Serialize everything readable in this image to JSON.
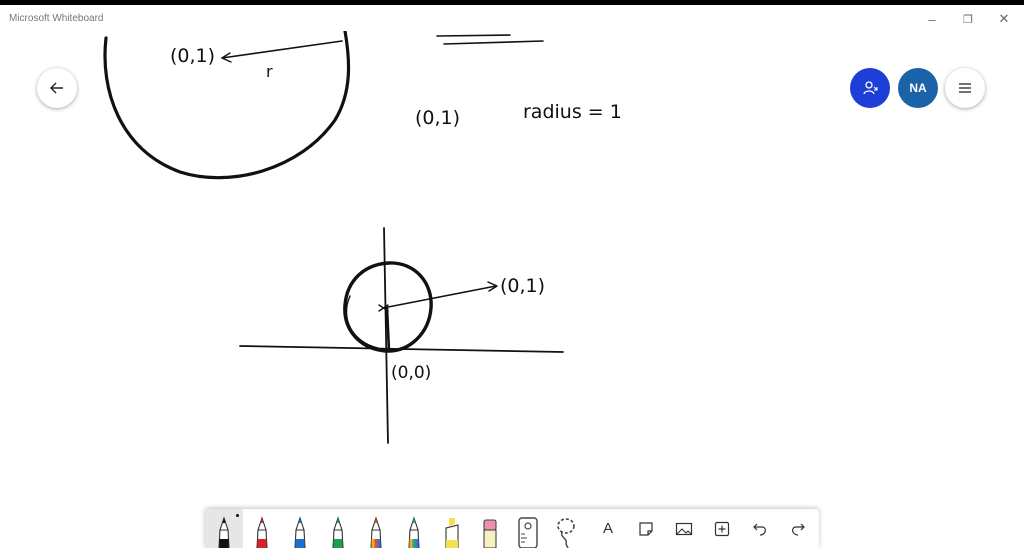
{
  "window": {
    "title": "Microsoft Whiteboard",
    "minimize_glyph": "–",
    "restore_glyph": "❐",
    "close_glyph": "✕"
  },
  "board": {
    "top_label": "(0,1)",
    "top_r": "r",
    "eq_point": "(0,1)",
    "eq_text": "radius = 1",
    "arrow_label": "(0,1)",
    "origin_label": "(0,0)"
  },
  "controls": {
    "back_icon": "arrow-left-icon",
    "share_icon": "person-share-icon",
    "avatar_initials": "NA",
    "menu_icon": "hamburger-icon"
  },
  "toolbar": {
    "tools": [
      {
        "name": "pen-black",
        "color": "#111111",
        "active": true
      },
      {
        "name": "pen-red",
        "color": "#d8222a"
      },
      {
        "name": "pen-blue",
        "color": "#1a6fd1"
      },
      {
        "name": "pen-green",
        "color": "#1e9e4a"
      },
      {
        "name": "pen-rainbow",
        "color": "#e0502a"
      },
      {
        "name": "pen-galaxy",
        "color": "#2aa198"
      },
      {
        "name": "highlighter",
        "color": "#f5e24a"
      },
      {
        "name": "eraser",
        "color": "#f08fb4"
      },
      {
        "name": "ruler",
        "color": "#444444"
      },
      {
        "name": "lasso",
        "color": "#444444"
      }
    ],
    "text_tool_label": "A",
    "note_icon": "sticky-note-icon",
    "image_icon": "image-icon",
    "add_icon": "add-icon",
    "undo_icon": "undo-icon",
    "redo_icon": "redo-icon"
  }
}
